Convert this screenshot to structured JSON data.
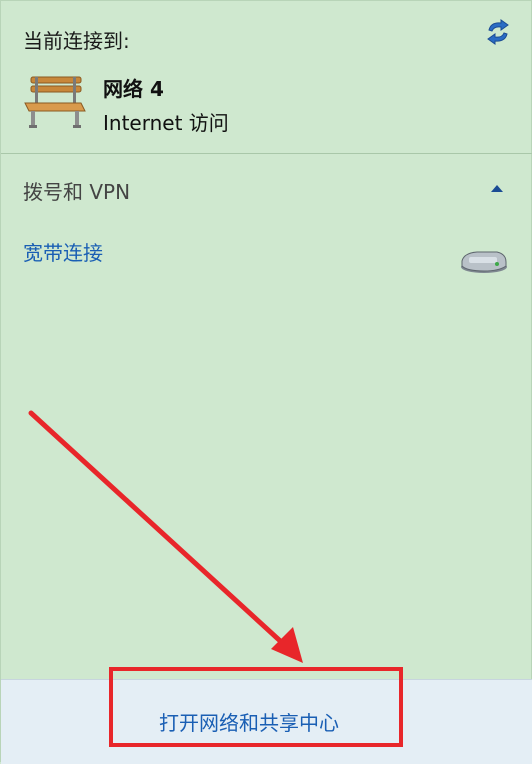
{
  "current_connection": {
    "title": "当前连接到:",
    "network_name": "网络  4",
    "network_access": "Internet 访问",
    "network_icon": "bench-icon",
    "refresh_icon": "network-refresh-icon"
  },
  "dialup_section": {
    "title": "拨号和 VPN",
    "collapse_icon": "chevron-up-icon",
    "items": [
      {
        "label": "宽带连接",
        "icon": "modem-icon"
      }
    ]
  },
  "footer": {
    "open_center_label": "打开网络和共享中心"
  },
  "colors": {
    "panel_background": "#cfe8cf",
    "footer_background": "#e4eef5",
    "link": "#1a5fb4",
    "annotation": "#e8262a"
  }
}
